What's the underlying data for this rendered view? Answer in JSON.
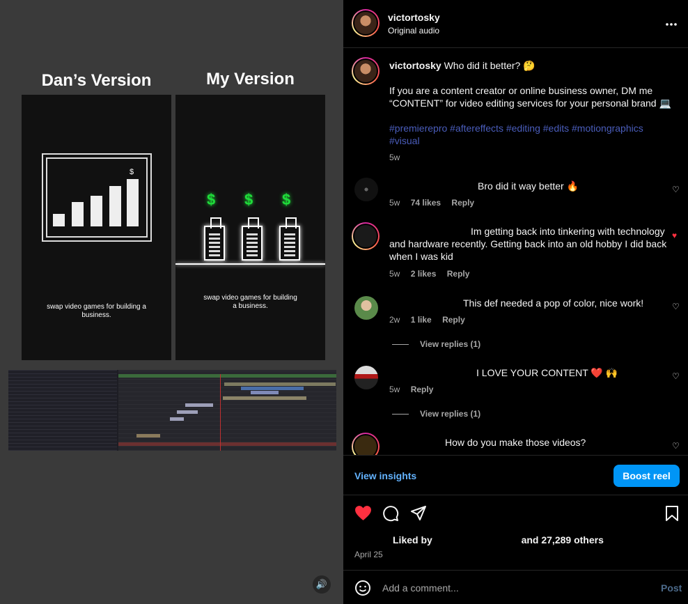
{
  "video": {
    "left_title": "Dan’s Version",
    "right_title": "My Version",
    "left_caption": "swap video games for building a business.",
    "right_caption": "swap video games for building a business.",
    "dollar_small": "$",
    "dollar_green": "$"
  },
  "header": {
    "username": "victortosky",
    "audio": "Original audio",
    "more": "•••"
  },
  "caption": {
    "username": "victortosky",
    "text": "Who did it better? 🤔",
    "body": "If you are a content creator or online business owner, DM me “CONTENT” for video editing services for your personal brand 💻",
    "hashtags": "#premierepro #aftereffects #editing #edits #motiongraphics #visual",
    "time": "5w"
  },
  "comments": [
    {
      "text": "Bro did it way better 🔥",
      "time": "5w",
      "likes": "74 likes",
      "reply": "Reply",
      "liked": false
    },
    {
      "text": "Im getting back into tinkering with technology and hardware recently. Getting back into an old hobby I did back when I was kid",
      "time": "5w",
      "likes": "2 likes",
      "reply": "Reply",
      "liked": true
    },
    {
      "text": "This def needed a pop of color, nice work!",
      "time": "2w",
      "likes": "1 like",
      "reply": "Reply",
      "liked": false,
      "view_replies": "View replies (1)"
    },
    {
      "text": "I LOVE YOUR CONTENT ❤️ 🙌",
      "time": "5w",
      "reply": "Reply",
      "liked": false,
      "view_replies": "View replies (1)"
    },
    {
      "text": "How do you make those videos?",
      "liked": false
    }
  ],
  "actions": {
    "view_insights": "View insights",
    "boost": "Boost reel"
  },
  "likes": {
    "prefix": "Liked by",
    "suffix": "and 27,289 others"
  },
  "date": "April 25",
  "composer": {
    "placeholder": "Add a comment...",
    "post": "Post"
  },
  "colors": {
    "accent": "#0095f6",
    "like_red": "#ff3040",
    "hashtag": "#4a5dbb",
    "money_green": "#1fdc3a"
  },
  "icons": [
    "heart-icon",
    "comment-icon",
    "share-icon",
    "bookmark-icon",
    "emoji-icon",
    "speaker-icon",
    "more-icon"
  ]
}
